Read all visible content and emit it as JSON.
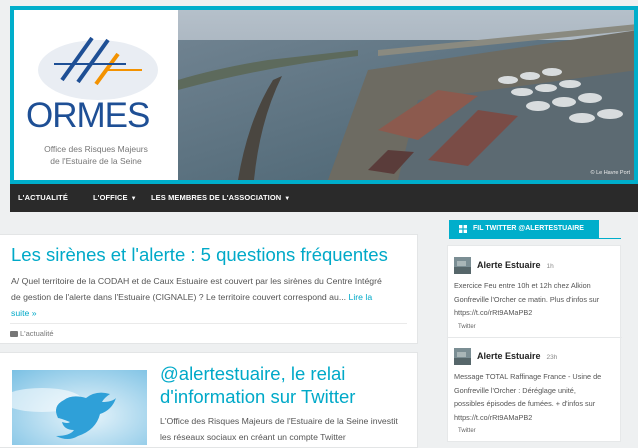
{
  "header": {
    "logo_word": "ORMES",
    "logo_sub_line1": "Office des Risques Majeurs",
    "logo_sub_line2": "de l'Estuaire de la Seine",
    "banner_credit": "© Le Havre Port"
  },
  "nav": {
    "items": [
      {
        "label": "L'ACTUALITÉ",
        "dropdown": false
      },
      {
        "label": "L'OFFICE",
        "dropdown": true
      },
      {
        "label": "LES MEMBRES DE L'ASSOCIATION",
        "dropdown": true
      }
    ],
    "caret": "▼"
  },
  "posts": [
    {
      "title": "Les sirènes et l'alerte : 5 questions fréquentes",
      "excerpt_lines": [
        "A/ Quel territoire de la CODAH et de Caux Estuaire est couvert par les sirènes du Centre Intégré",
        "de gestion de l'alerte dans l'Estuaire (CIGNALE) ? Le territoire couvert correspond au..."
      ],
      "read_more_line1": "Lire la",
      "read_more_line2": "suite »",
      "category": "L'actualité"
    },
    {
      "title_line1": "@alertestuaire, le relai",
      "title_line2": "d'information sur Twitter",
      "excerpt_lines": [
        "L'Office des Risques Majeurs de l'Estuaire de la Seine investit",
        "les réseaux sociaux en créant un compte Twitter"
      ]
    }
  ],
  "sidebar": {
    "twitter_heading": "FIL TWITTER @ALERTESTUAIRE",
    "tweets": [
      {
        "name": "Alerte Estuaire",
        "time": "1h",
        "lines": [
          "Exercice Feu entre 10h et 12h chez Alkion",
          "Gonfreville l'Orcher ce matin. Plus d'infos sur",
          "https://t.co/rRt9AMaPB2"
        ],
        "source": "Twitter"
      },
      {
        "name": "Alerte Estuaire",
        "time": "23h",
        "lines": [
          "Message TOTAL Raffinage France - Usine de",
          "Gonfreville l'Orcher : Déréglage unité,",
          "possibles épisodes de fumées. + d'infos sur",
          "https://t.co/rRt9AMaPB2"
        ],
        "source": "Twitter"
      }
    ]
  },
  "colors": {
    "accent": "#00aecb",
    "link": "#00a9c8",
    "nav_bg": "#2a2a2a",
    "logo_blue": "#1e4f95",
    "logo_orange": "#f39200"
  },
  "icons": {
    "folder": "folder-icon",
    "grid": "grid-icon",
    "caret": "caret-down-icon"
  }
}
